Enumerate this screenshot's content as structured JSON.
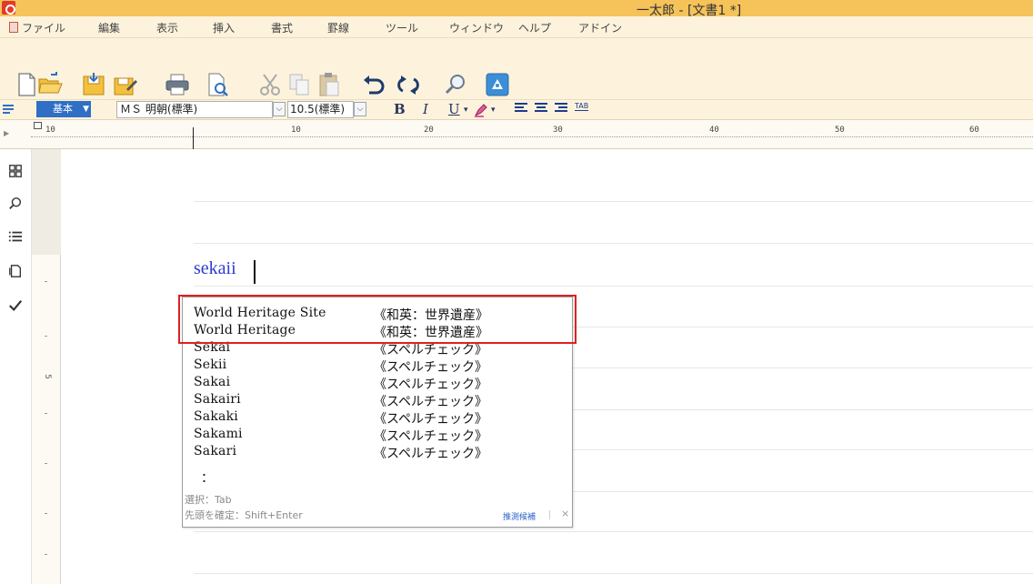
{
  "window": {
    "title": "一太郎 - [文書1 *]"
  },
  "menu": [
    "ファイル",
    "編集",
    "表示",
    "挿入",
    "書式",
    "罫線",
    "ツール",
    "ウィンドウ",
    "ヘルプ",
    "アドイン"
  ],
  "toolbar": {
    "icons": [
      "new-document-icon",
      "open-folder-icon",
      "save-icon",
      "save-as-icon",
      "print-icon",
      "print-preview-icon",
      "cut-icon",
      "copy-icon",
      "paste-icon",
      "undo-icon",
      "redo-icon",
      "search-icon",
      "help-icon"
    ]
  },
  "format_bar": {
    "style": "基本",
    "font": "ＭＳ 明朝(標準)",
    "size": "10.5(標準)",
    "bold": "B",
    "italic": "I",
    "underline": "U",
    "tab": "TAB"
  },
  "ruler": {
    "left_box_label": "10",
    "labels": [
      "10",
      "20",
      "30",
      "40",
      "50",
      "60"
    ]
  },
  "vertical_ruler": {
    "label": "5"
  },
  "document": {
    "text": "sekaii"
  },
  "suggestions": {
    "items": [
      {
        "word": "World Heritage Site",
        "tag": "《和英：世界遺産》"
      },
      {
        "word": "World Heritage",
        "tag": "《和英：世界遺産》"
      },
      {
        "word": "Sekai",
        "tag": "《スペルチェック》"
      },
      {
        "word": "Sekii",
        "tag": "《スペルチェック》"
      },
      {
        "word": "Sakai",
        "tag": "《スペルチェック》"
      },
      {
        "word": "Sakairi",
        "tag": "《スペルチェック》"
      },
      {
        "word": "Sakaki",
        "tag": "《スペルチェック》"
      },
      {
        "word": "Sakami",
        "tag": "《スペルチェック》"
      },
      {
        "word": "Sakari",
        "tag": "《スペルチェック》"
      }
    ],
    "more": "：",
    "hint_select": "選択：Tab",
    "hint_confirm": "先頭を確定：Shift+Enter",
    "predict_label": "推測候補",
    "close": "×"
  },
  "colors": {
    "accent": "#e02020",
    "title_bar": "#f5c35a",
    "doc_text": "#2d3bcf"
  }
}
